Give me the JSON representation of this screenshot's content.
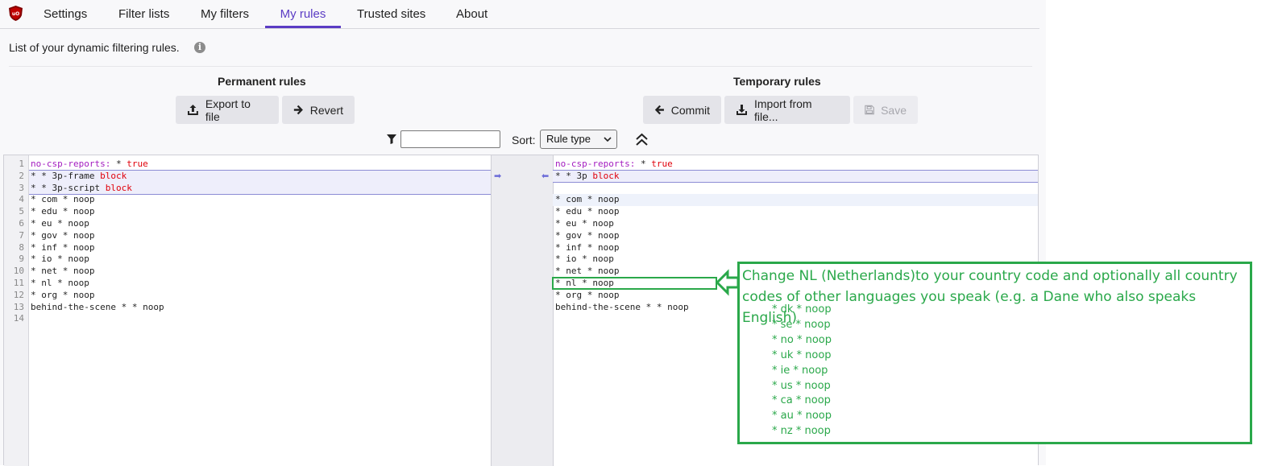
{
  "nav": {
    "tabs": [
      {
        "label": "Settings"
      },
      {
        "label": "Filter lists"
      },
      {
        "label": "My filters"
      },
      {
        "label": "My rules"
      },
      {
        "label": "Trusted sites"
      },
      {
        "label": "About"
      }
    ],
    "active_tab": "My rules",
    "accent_color": "#5b3cc4"
  },
  "description": "List of your dynamic filtering rules.",
  "permanent": {
    "title": "Permanent rules",
    "export_label": "Export to file",
    "revert_label": "Revert",
    "lines": [
      {
        "num": "1",
        "text": "no-csp-reports: * true"
      },
      {
        "num": "2",
        "text": "* * 3p-frame block"
      },
      {
        "num": "3",
        "text": "* * 3p-script block"
      },
      {
        "num": "4",
        "text": "* com * noop"
      },
      {
        "num": "5",
        "text": "* edu * noop"
      },
      {
        "num": "6",
        "text": "* eu * noop"
      },
      {
        "num": "7",
        "text": "* gov * noop"
      },
      {
        "num": "8",
        "text": "* inf * noop"
      },
      {
        "num": "9",
        "text": "* io * noop"
      },
      {
        "num": "10",
        "text": "* net * noop"
      },
      {
        "num": "11",
        "text": "* nl * noop"
      },
      {
        "num": "12",
        "text": "* org * noop"
      },
      {
        "num": "13",
        "text": "behind-the-scene * * noop"
      },
      {
        "num": "14",
        "text": ""
      }
    ]
  },
  "temporary": {
    "title": "Temporary rules",
    "commit_label": "Commit",
    "import_label": "Import from file...",
    "save_label": "Save",
    "lines": [
      "no-csp-reports: * true",
      "* * 3p block",
      "",
      "* com * noop",
      "* edu * noop",
      "* eu * noop",
      "* gov * noop",
      "* inf * noop",
      "* io * noop",
      "* net * noop",
      "* nl * noop",
      "* org * noop",
      "behind-the-scene * * noop"
    ]
  },
  "toolbar": {
    "filter_value": "",
    "sort_label": "Sort:",
    "sort_selected": "Rule type"
  },
  "annotation": {
    "line1": "Change NL (Netherlands)to your country code and optionally all country",
    "line2": "codes of other languages you speak (e.g. a Dane who also speaks English)",
    "codes": [
      "* dk * noop",
      "* se * noop",
      "* no * noop",
      "* uk * noop",
      "* ie * noop",
      "* us * noop",
      "* ca * noop",
      "* au * noop",
      "* nz * noop"
    ],
    "color": "#2aa84a"
  }
}
